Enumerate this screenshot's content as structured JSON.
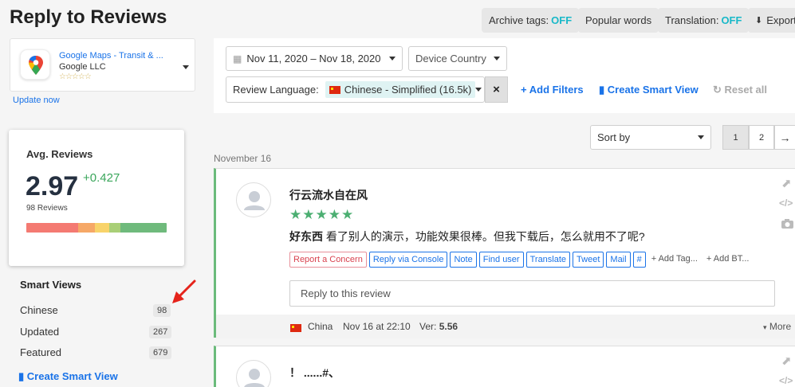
{
  "page": {
    "title": "Reply to Reviews"
  },
  "header_buttons": {
    "archive_label": "Archive tags:",
    "archive_state": "OFF",
    "popular_words": "Popular words",
    "translation_label": "Translation:",
    "translation_state": "OFF",
    "export": "Export"
  },
  "app": {
    "name": "Google Maps - Transit & ...",
    "developer": "Google LLC",
    "stars": "☆☆☆☆☆",
    "update_link": "Update now"
  },
  "avg_reviews": {
    "title": "Avg. Reviews",
    "value": "2.97",
    "delta": "+0.427",
    "count": "98 Reviews",
    "bar_colors": [
      "#f47a72",
      "#f6a867",
      "#f8d36a",
      "#a9cf77",
      "#6fba7c"
    ],
    "bar_fractions": [
      0.37,
      0.12,
      0.1,
      0.08,
      0.33
    ]
  },
  "smart_views": {
    "title": "Smart Views",
    "items": [
      {
        "label": "Chinese",
        "count": "98"
      },
      {
        "label": "Updated",
        "count": "267"
      },
      {
        "label": "Featured",
        "count": "679"
      }
    ],
    "create_label": "Create Smart View"
  },
  "filters": {
    "date_range": "Nov 11, 2020 – Nov 18, 2020",
    "device_country": "Device Country",
    "review_language_label": "Review Language:",
    "language_chip": "Chinese - Simplified (16.5k)",
    "clear": "×",
    "add_filters": "Add Filters",
    "create_smart_view": "Create Smart View",
    "reset_all": "Reset all"
  },
  "list": {
    "sort_by": "Sort by",
    "pages": [
      "1",
      "2"
    ],
    "next": "→",
    "date_group": "November 16"
  },
  "reviews": [
    {
      "title": "行云流水自在风",
      "stars": "★★★★★",
      "rating": 5,
      "body_bold": "好东西",
      "body": " 看了别人的演示，功能效果很棒。但我下载后，怎么就用不了呢?",
      "actions": [
        "Report a Concern",
        "Reply via Console",
        "Note",
        "Find user",
        "Translate",
        "Tweet",
        "Mail",
        "#"
      ],
      "add_tag": "+ Add Tag...",
      "add_bt": "+ Add BT...",
      "reply_placeholder": "Reply to this review",
      "country": "China",
      "date": "Nov 16 at 22:10",
      "version_label": "Ver:",
      "version": "5.56",
      "more": "More"
    },
    {
      "title": "！ ......#、"
    }
  ]
}
